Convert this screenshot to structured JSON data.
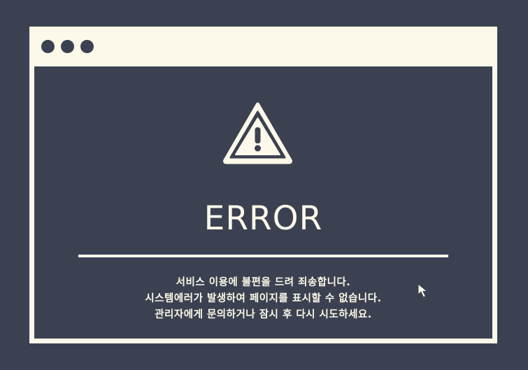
{
  "window": {
    "controls": [
      "dot",
      "dot",
      "dot"
    ]
  },
  "error": {
    "icon": "warning-icon",
    "title": "ERROR",
    "message_lines": [
      "서비스 이용에 불편을 드려 죄송합니다.",
      "시스템에러가 발생하여 페이지를 표시할 수 없습니다.",
      "관리자에게 문의하거나 잠시 후 다시 시도하세요."
    ]
  },
  "cursor": {
    "icon": "mouse-pointer-icon"
  },
  "colors": {
    "background": "#3b4150",
    "window_frame": "#fcf9ea",
    "text": "#fcf9ea"
  }
}
